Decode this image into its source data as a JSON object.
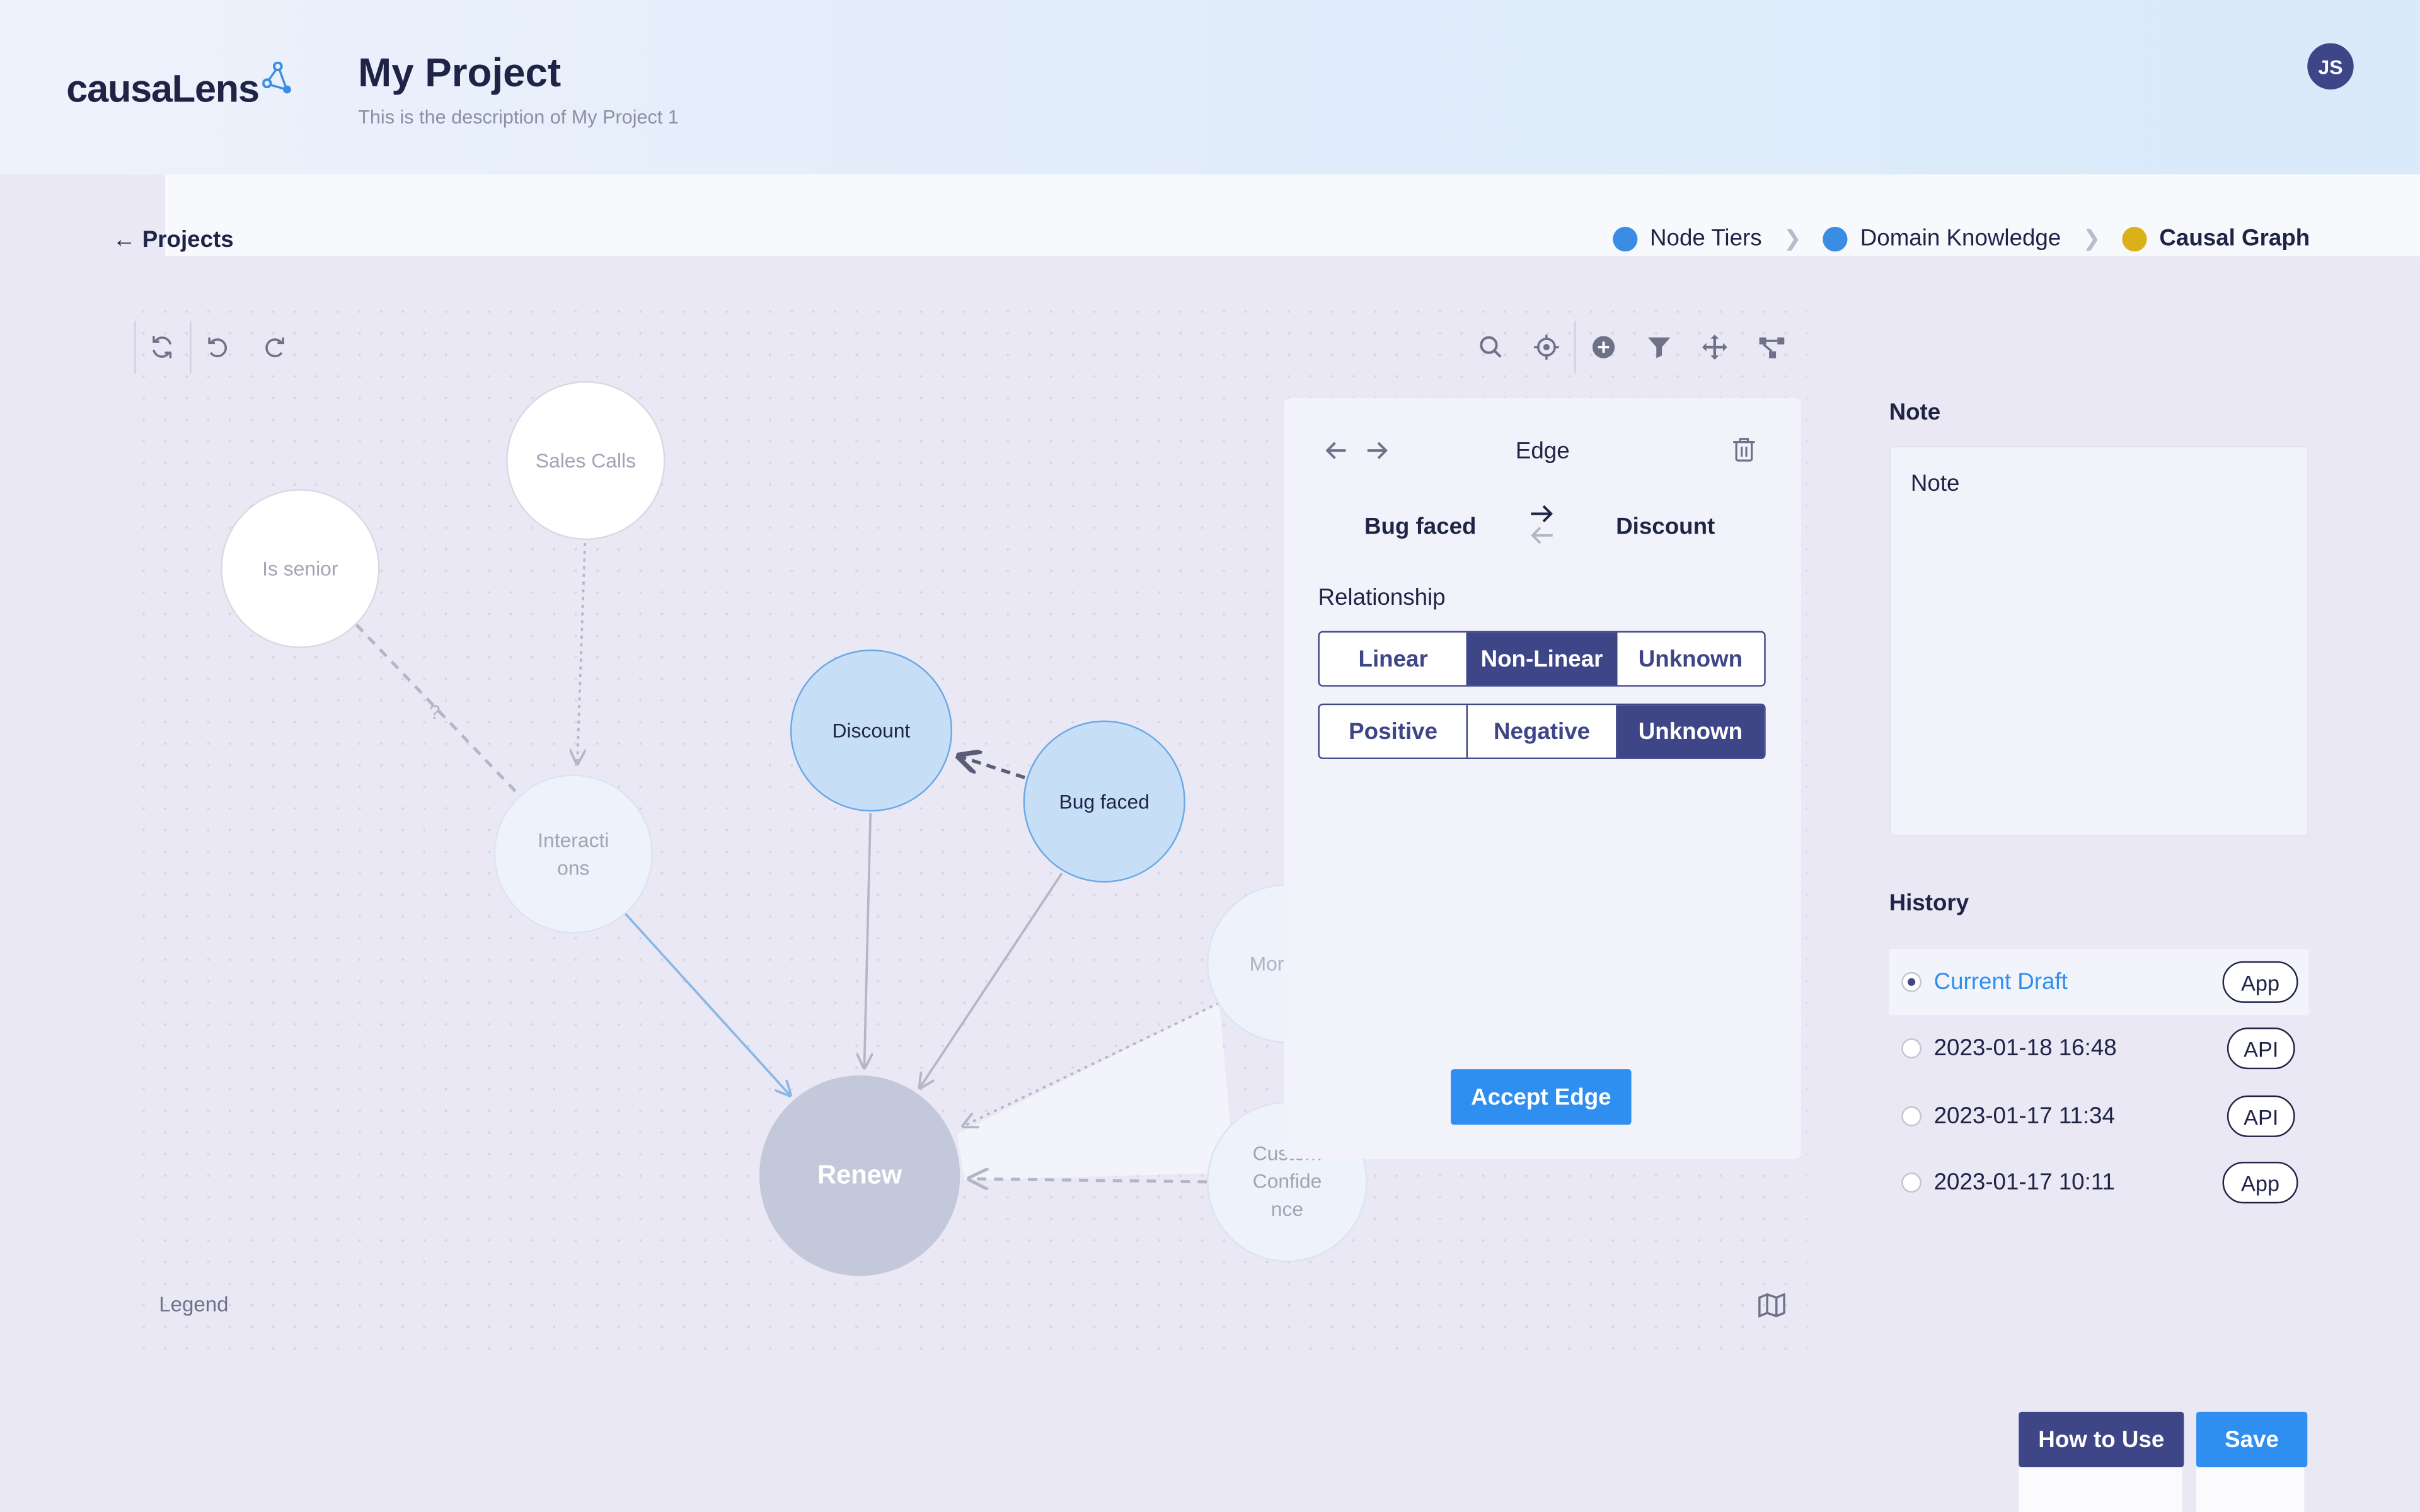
{
  "header": {
    "logo_text": "causaLens",
    "project_title": "My Project",
    "project_description": "This is the description of My Project 1",
    "avatar_initials": "JS"
  },
  "nav": {
    "back_label": "← Projects",
    "steps": [
      {
        "label": "Node Tiers",
        "color": "#3b8de3"
      },
      {
        "label": "Domain Knowledge",
        "color": "#3b8de3"
      },
      {
        "label": "Causal Graph",
        "color": "#dbb11a"
      }
    ]
  },
  "toolbar": {
    "left_tools": [
      "refresh-icon",
      "undo-icon",
      "redo-icon"
    ],
    "right_tools": [
      "search-icon",
      "crosshair-icon",
      "add-circle-icon",
      "filter-icon",
      "move-icon",
      "graph-layout-icon"
    ]
  },
  "graph": {
    "nodes": [
      {
        "id": "sales-calls",
        "label": "Sales Calls"
      },
      {
        "id": "is-senior",
        "label": "Is senior"
      },
      {
        "id": "interactions",
        "label": "Interacti ons"
      },
      {
        "id": "discount",
        "label": "Discount"
      },
      {
        "id": "bug-faced",
        "label": "Bug faced"
      },
      {
        "id": "renew",
        "label": "Renew"
      },
      {
        "id": "more-usage",
        "label": "Mor Us"
      },
      {
        "id": "customer-confidence",
        "label": "Custom Confide nce"
      }
    ],
    "edges": [
      {
        "from": "sales-calls",
        "to": "interactions",
        "style": "dotted"
      },
      {
        "from": "is-senior",
        "to": "interactions",
        "style": "dashed",
        "label": "?"
      },
      {
        "from": "interactions",
        "to": "renew",
        "style": "solid"
      },
      {
        "from": "discount",
        "to": "renew",
        "style": "solid"
      },
      {
        "from": "bug-faced",
        "to": "renew",
        "style": "solid"
      },
      {
        "from": "bug-faced",
        "to": "discount",
        "style": "dashed"
      },
      {
        "from": "customer-confidence",
        "to": "renew",
        "style": "dashed"
      },
      {
        "from": "more-usage",
        "to": "renew",
        "style": "dotted"
      }
    ]
  },
  "legend_label": "Legend",
  "edge_panel": {
    "title": "Edge",
    "from": "Bug faced",
    "to": "Discount",
    "relationship_label": "Relationship",
    "relationship_options": [
      "Linear",
      "Non-Linear",
      "Unknown"
    ],
    "relationship_selected": "Non-Linear",
    "direction_options": [
      "Positive",
      "Negative",
      "Unknown"
    ],
    "direction_selected": "Unknown",
    "accept_label": "Accept Edge"
  },
  "note": {
    "heading": "Note",
    "text": "Note"
  },
  "history": {
    "heading": "History",
    "items": [
      {
        "label": "Current Draft",
        "badge": "App",
        "selected": true
      },
      {
        "label": "2023-01-18 16:48",
        "badge": "API",
        "selected": false
      },
      {
        "label": "2023-01-17 11:34",
        "badge": "API",
        "selected": false
      },
      {
        "label": "2023-01-17 10:11",
        "badge": "App",
        "selected": false
      }
    ]
  },
  "actions": {
    "how_to_use_label": "How to Use",
    "save_label": "Save"
  },
  "colors": {
    "primary": "#3e4688",
    "accent": "#2f8ff0",
    "selected_node": "#c7def7"
  }
}
